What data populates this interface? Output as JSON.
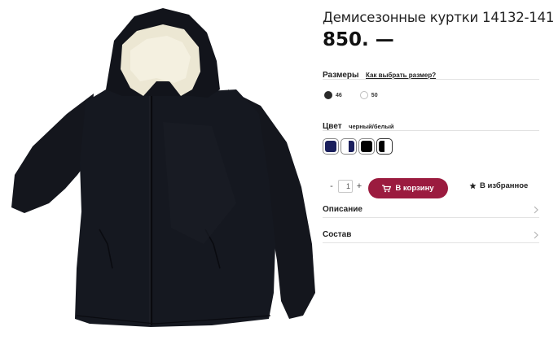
{
  "product": {
    "title": "Демисезонные куртки 14132-141",
    "price": "850. —"
  },
  "sizes": {
    "label": "Размеры",
    "guide_link": "Как выбрать размер?",
    "options": [
      {
        "value": "46",
        "selected": true
      },
      {
        "value": "50",
        "selected": false
      }
    ]
  },
  "color": {
    "label": "Цвет",
    "value": "черный/белый",
    "swatches": [
      {
        "name": "dark-navy",
        "colors": [
          "#1a1f5c"
        ]
      },
      {
        "name": "white-navy",
        "colors": [
          "#ffffff",
          "#1a1f5c"
        ]
      },
      {
        "name": "black",
        "colors": [
          "#000000"
        ]
      },
      {
        "name": "black-white",
        "colors": [
          "#000000",
          "#ffffff"
        ]
      }
    ]
  },
  "quantity": {
    "minus": "-",
    "value": "1",
    "plus": "+"
  },
  "actions": {
    "cart_label": "В корзину",
    "favorite_label": "В избранное",
    "accent_color": "#9b1b3f"
  },
  "accordion": {
    "description": "Описание",
    "composition": "Состав"
  },
  "icons": {
    "cart": "shopping-cart-icon",
    "favorite": "star-icon",
    "chevron": "chevron-right-icon"
  }
}
